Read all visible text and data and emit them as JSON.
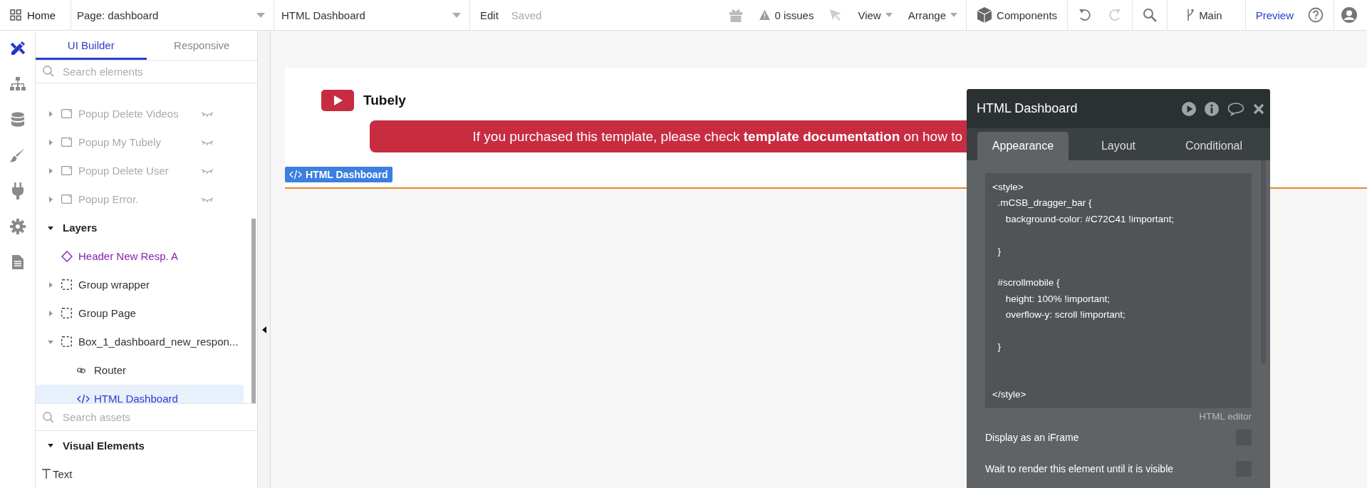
{
  "toolbar": {
    "home": "Home",
    "page_select": "Page: dashboard",
    "element_select": "HTML Dashboard",
    "edit": "Edit",
    "save_status": "Saved",
    "issues": "0 issues",
    "view": "View",
    "arrange": "Arrange",
    "components": "Components",
    "branch": "Main",
    "preview": "Preview"
  },
  "rail": [
    {
      "kind": "design",
      "selected": true
    },
    {
      "kind": "workflow",
      "selected": false
    },
    {
      "kind": "data",
      "selected": false
    },
    {
      "kind": "styles",
      "selected": false
    },
    {
      "kind": "plugins",
      "selected": false
    },
    {
      "kind": "settings",
      "selected": false
    },
    {
      "kind": "logs",
      "selected": false
    }
  ],
  "sidebar": {
    "tabs": [
      {
        "label": "UI Builder",
        "selected": true
      },
      {
        "label": "Responsive",
        "selected": false
      }
    ],
    "search": {
      "placeholder": "Search elements"
    },
    "tree": [
      {
        "label": "Popup Delete Videos",
        "kind": "popup",
        "expanded": false,
        "hidden": true,
        "selected": false
      },
      {
        "label": "Popup My Tubely",
        "kind": "popup",
        "expanded": false,
        "hidden": true,
        "selected": false
      },
      {
        "label": "Popup Delete User",
        "kind": "popup",
        "expanded": false,
        "hidden": true,
        "selected": false
      },
      {
        "label": "Popup Error.",
        "kind": "popup",
        "expanded": false,
        "hidden": true,
        "selected": false
      },
      {
        "label": "Layers",
        "kind": "section",
        "expanded": true,
        "selected": false,
        "children": [
          {
            "label": "Header New Resp. A",
            "kind": "reusable",
            "selected": false
          },
          {
            "label": "Group wrapper",
            "kind": "group",
            "expanded": false,
            "selected": false
          },
          {
            "label": "Group Page",
            "kind": "group",
            "expanded": false,
            "selected": false
          },
          {
            "label": "Box_1_dashboard_new_respon...",
            "kind": "group",
            "expanded": true,
            "selected": false,
            "children": [
              {
                "label": "Router",
                "kind": "link",
                "selected": false
              },
              {
                "label": "HTML Dashboard",
                "kind": "html",
                "selected": true
              }
            ]
          }
        ]
      }
    ],
    "assets_search": {
      "placeholder": "Search assets"
    },
    "visual_elements": {
      "label": "Visual Elements",
      "expanded": true,
      "children": [
        {
          "label": "Text",
          "kind": "text"
        }
      ]
    }
  },
  "canvas": {
    "app_name": "Tubely",
    "banner": "If you purchased this template, please check **template documentation** on how to",
    "element_tag": "HTML Dashboard"
  },
  "panel": {
    "title": "HTML Dashboard",
    "tabs": [
      {
        "label": "Appearance",
        "selected": true
      },
      {
        "label": "Layout",
        "selected": false
      },
      {
        "label": "Conditional",
        "selected": false
      }
    ],
    "code": "<style>\n  .mCSB_dragger_bar {\n     background-color: #C72C41 !important;\n\n  }\n\n  #scrollmobile {\n     height: 100% !important;\n     overflow-y: scroll !important;\n\n  }\n\n\n</style>",
    "editor_label": "HTML editor",
    "options": [
      {
        "label": "Display as an iFrame",
        "checked": false
      },
      {
        "label": "Wait to render this element until it is visible",
        "checked": false
      }
    ]
  }
}
